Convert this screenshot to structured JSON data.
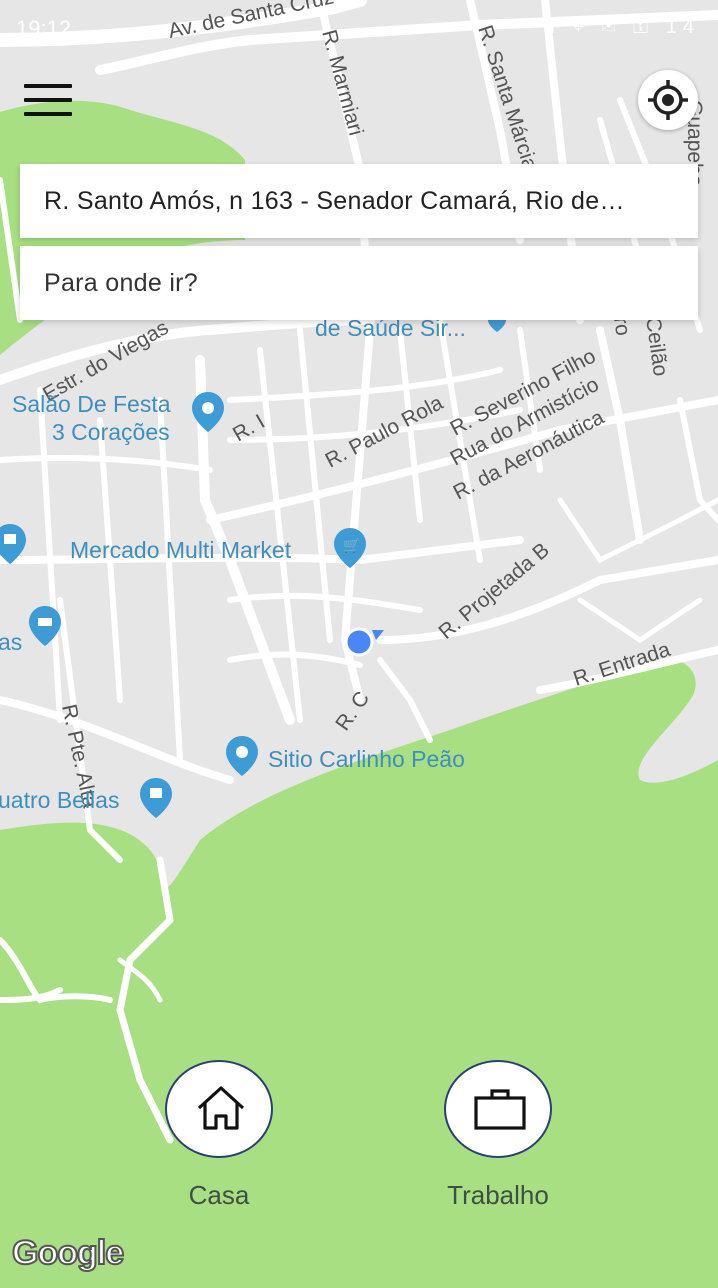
{
  "status_bar": {
    "time": "19:12",
    "icons": "f ⌖ ✉ ⚿ 14"
  },
  "search": {
    "origin": "R. Santo Amós, n 163 - Senador Camará, Rio de…",
    "destination_placeholder": "Para onde ir?"
  },
  "shortcuts": {
    "home_label": "Casa",
    "work_label": "Trabalho"
  },
  "map": {
    "attribution": "Google",
    "colors": {
      "land": "#e6e6e6",
      "road": "#ffffff",
      "park": "#a8df82",
      "poi": "#3d9bd6",
      "user_dot": "#4a86f4",
      "label": "#444444"
    },
    "street_labels": [
      "Av. de Santa Cruz",
      "R. Marmiari",
      "R. Santa Márcia",
      "Guapeba",
      "Estr. do Viegas",
      "R. I",
      "R. Paulo Rola",
      "R. Severino Filho",
      "Rua do Armistício",
      "R. da Aeronáutica",
      "Ceilão",
      "ro",
      "R. Projetada B",
      "R. Entrada",
      "R. C",
      "R. Pte. Alta"
    ],
    "poi_labels": [
      "de Saúde Sir...",
      "Salão De Festa",
      "3 Corações",
      "Mercado Multi Market",
      "Sitio Carlinho Peão",
      "uatro Bellas",
      "as"
    ]
  }
}
